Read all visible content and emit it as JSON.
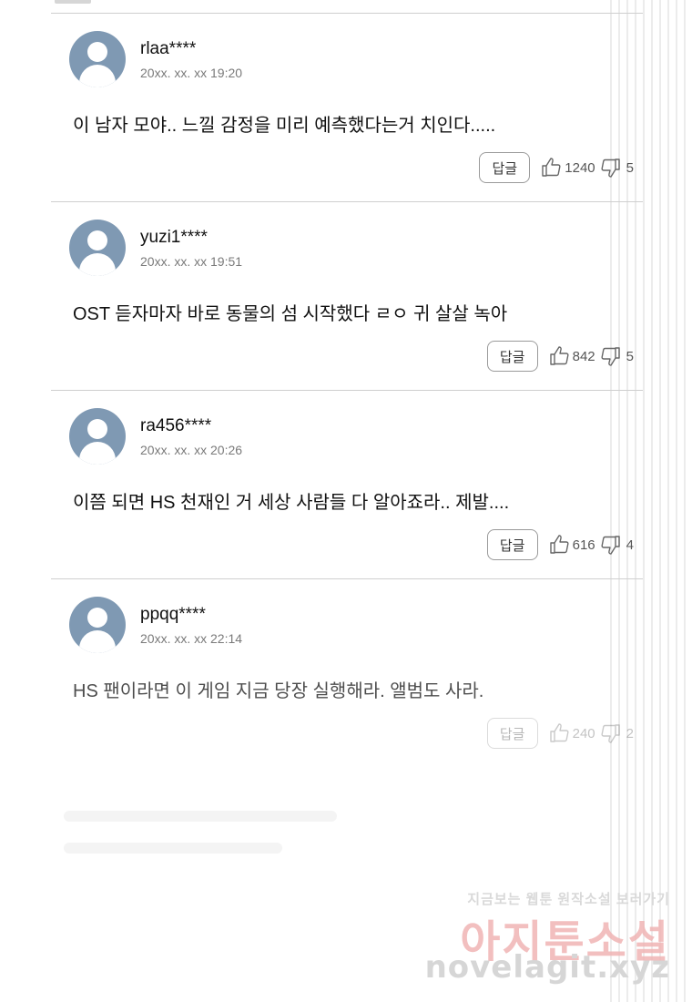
{
  "comments": [
    {
      "user": "rlaa****",
      "date": "20xx. xx. xx  19:20",
      "text": "이 남자 모야.. 느낄 감정을 미리 예측했다는거 치인다.....",
      "reply_label": "답글",
      "likes": "1240",
      "dislikes": "5"
    },
    {
      "user": "yuzi1****",
      "date": "20xx. xx. xx  19:51",
      "text": "OST 듣자마자 바로 동물의 섬 시작했다 ㄹㅇ 귀 살살 녹아",
      "reply_label": "답글",
      "likes": "842",
      "dislikes": "5"
    },
    {
      "user": "ra456****",
      "date": "20xx. xx. xx  20:26",
      "text": "이쯤 되면 HS 천재인 거 세상 사람들 다 알아죠라.. 제발....",
      "reply_label": "답글",
      "likes": "616",
      "dislikes": "4"
    },
    {
      "user": "ppqq****",
      "date": "20xx. xx. xx  22:14",
      "text": "HS 팬이라면 이 게임 지금 당장 실행해라. 앨범도 사라.",
      "reply_label": "답글",
      "likes": "240",
      "dislikes": "2"
    }
  ],
  "icons": {
    "like": "thumbs-up-icon",
    "dislike": "thumbs-down-icon",
    "avatar": "user-avatar-icon"
  },
  "watermark": {
    "line1": "지금보는 웹툰 원작소설 보러가기",
    "line2": "아지툰소설",
    "line3": "novelagit.xyz"
  },
  "colors": {
    "avatar": "#7f99b3",
    "divider": "#cfcfcf",
    "watermark_red": "#f0b4b4"
  }
}
